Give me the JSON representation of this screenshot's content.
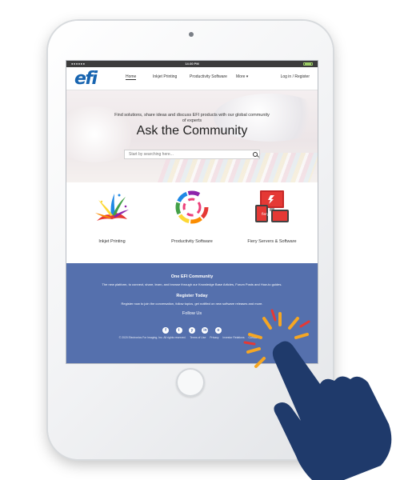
{
  "statusbar": {
    "carrier": "●●●●●●",
    "time": "14:30 PM"
  },
  "brand": {
    "logo_text": "efi",
    "logo_color": "#1764b0",
    "footer_color": "#5570ad"
  },
  "nav": {
    "items": [
      "Home",
      "Inkjet Printing",
      "Productivity Software",
      "More ▾"
    ],
    "login": "Log in / Register"
  },
  "hero": {
    "subtitle": "Find solutions, share ideas and discuss EFI products with our global community of experts",
    "title": "Ask the Community",
    "search_placeholder": "Start by searching here..."
  },
  "categories": [
    {
      "label": "Inkjet Printing",
      "icon": "ink-splash-icon"
    },
    {
      "label": "Productivity Software",
      "icon": "color-wheel-icon"
    },
    {
      "label": "Fiery Servers & Software",
      "icon": "fiery-devices-icon"
    }
  ],
  "footer": {
    "community_title": "One EFI Community",
    "community_text": "The new platform, to connect, share, learn, and browse through our Knowledge Base Articles, Forum Posts and How-to guides.",
    "register_title": "Register Today",
    "register_text": "Register now to join the conversation, follow topics, get notified on new software releases and more.",
    "follow_title": "Follow Us",
    "social": [
      "f",
      "t",
      "y",
      "in",
      "o"
    ],
    "copyright": "© 2020 Electronics For Imaging, Inc. All rights reserved.",
    "links": [
      "Terms of Use",
      "Privacy",
      "Investor Relations",
      "Contact Us"
    ]
  }
}
